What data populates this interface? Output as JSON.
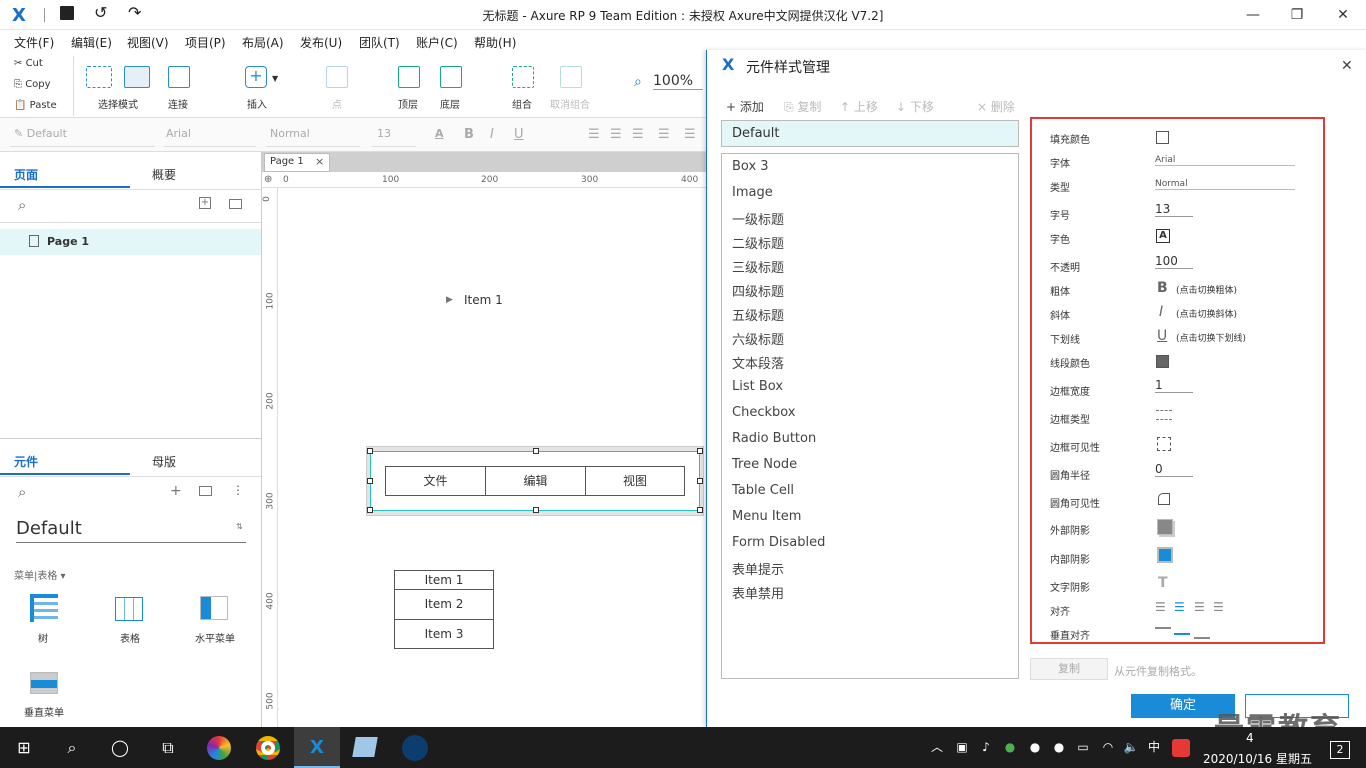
{
  "window": {
    "title": "无标题 - Axure RP 9 Team Edition : 未授权    Axure中文网提供汉化 V7.2]",
    "minimize": "—",
    "maximize": "❐",
    "close": "✕"
  },
  "menubar": {
    "items": [
      "文件(F)",
      "编辑(E)",
      "视图(V)",
      "项目(P)",
      "布局(A)",
      "发布(U)",
      "团队(T)",
      "账户(C)",
      "帮助(H)"
    ]
  },
  "toolbar": {
    "cut": "Cut",
    "copy": "Copy",
    "paste": "Paste",
    "select_mode": "选择模式",
    "connect": "连接",
    "insert": "插入",
    "point": "点",
    "top_layer": "顶层",
    "bottom_layer": "底层",
    "group": "组合",
    "ungroup": "取消组合",
    "zoom": "100%"
  },
  "formatbar": {
    "style": "Default",
    "font": "Arial",
    "weight": "Normal",
    "size": "13",
    "bold": "B",
    "italic": "I",
    "underline": "U"
  },
  "leftpanel": {
    "tab_pages": "页面",
    "tab_outline": "概要",
    "page_item": "Page 1",
    "tab_widgets": "元件",
    "tab_masters": "母版",
    "library": "Default",
    "category": "菜单|表格 ▾",
    "widgets": [
      "树",
      "表格",
      "水平菜单",
      "垂直菜单"
    ]
  },
  "canvas": {
    "page_tab": "Page 1",
    "ruler_top": [
      "0",
      "100",
      "200",
      "300",
      "400"
    ],
    "ruler_left": [
      "0",
      "100",
      "200",
      "300",
      "400",
      "500"
    ],
    "tree_item": "Item 1",
    "hmenu": [
      "文件",
      "编辑",
      "视图"
    ],
    "vmenu": [
      "Item 1",
      "Item 2",
      "Item 3"
    ]
  },
  "dialog": {
    "title": "元件样式管理",
    "close": "✕",
    "add": "+ 添加",
    "duplicate": "复制",
    "move_up": "上移",
    "move_down": "下移",
    "delete": "删除",
    "default_style": "Default",
    "styles": [
      "Box 3",
      "Image",
      "一级标题",
      "二级标题",
      "三级标题",
      "四级标题",
      "五级标题",
      "六级标题",
      "文本段落",
      "List Box",
      "Checkbox",
      "Radio Button",
      "Tree Node",
      "Table Cell",
      "Menu Item",
      "Form Disabled",
      "表单提示",
      "表单禁用"
    ],
    "props": {
      "fill_color": "填充颜色",
      "font": "字体",
      "font_value": "Arial",
      "type": "类型",
      "type_value": "Normal",
      "font_size": "字号",
      "font_size_value": "13",
      "font_color": "字色",
      "opacity": "不透明",
      "opacity_value": "100",
      "bold": "粗体",
      "bold_hint": "(点击切换粗体)",
      "italic": "斜体",
      "italic_hint": "(点击切换斜体)",
      "underline": "下划线",
      "underline_hint": "(点击切换下划线)",
      "line_color": "线段颜色",
      "border_width": "边框宽度",
      "border_width_value": "1",
      "border_type": "边框类型",
      "border_visible": "边框可见性",
      "corner_radius": "圆角半径",
      "corner_radius_value": "0",
      "corner_visible": "圆角可见性",
      "outer_shadow": "外部阴影",
      "inner_shadow": "内部阴影",
      "text_shadow": "文字阴影",
      "align": "对齐",
      "valign": "垂直对齐"
    },
    "copy_btn": "复制",
    "copy_hint": "从元件复制格式。",
    "ok": "确定"
  },
  "watermark": "最需教育",
  "taskbar": {
    "time": "4",
    "date": "2020/10/16 星期五",
    "ime": "中",
    "notif": "2"
  }
}
